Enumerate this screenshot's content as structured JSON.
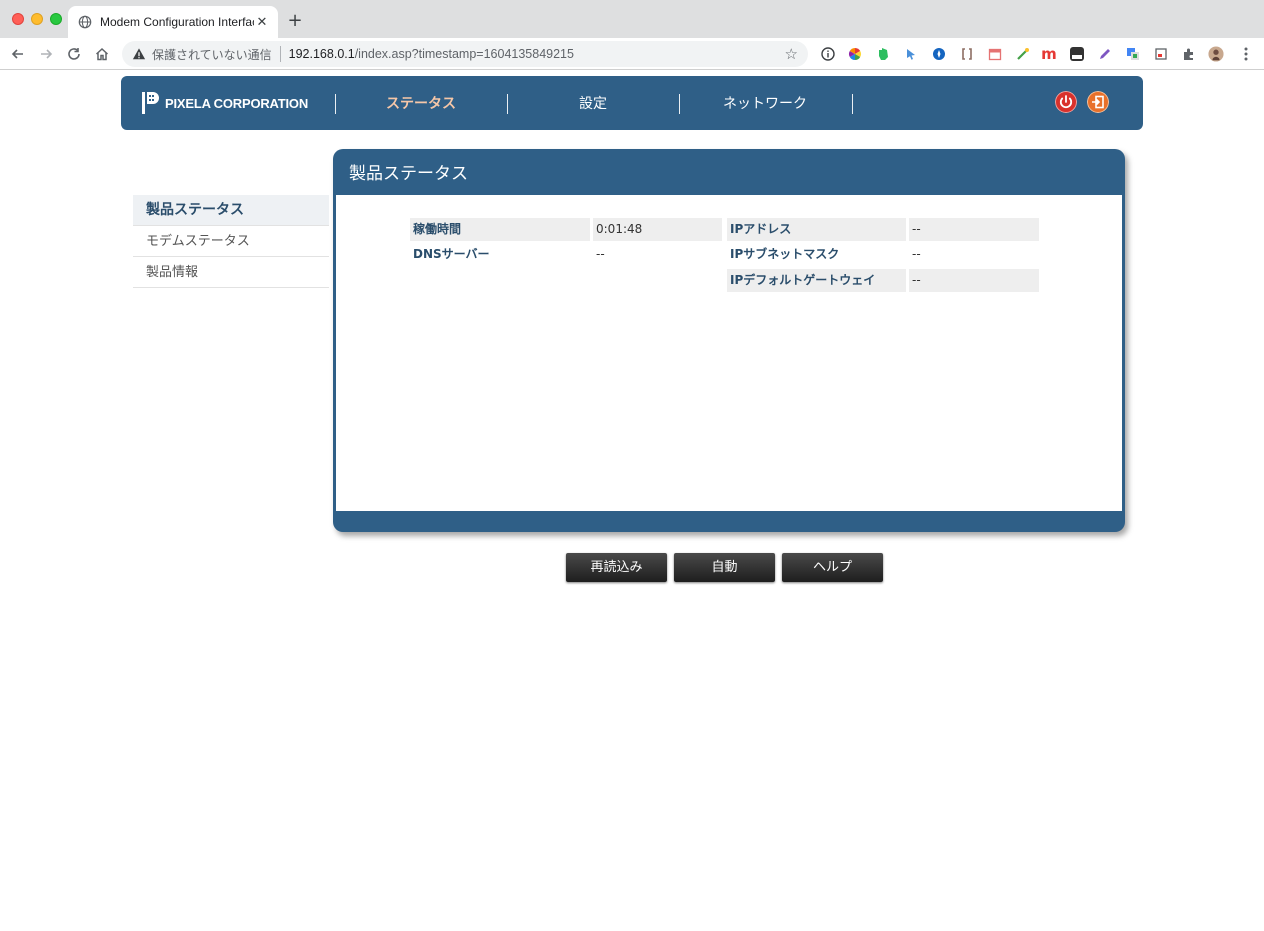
{
  "browser": {
    "tab_title": "Modem Configuration Interface",
    "tab_close": "✕",
    "new_tab": "+",
    "address_insecure_label": "保護されていない通信",
    "address_host": "192.168.0.1",
    "address_path": "/index.asp?timestamp=1604135849215",
    "extensions": [
      "info-icon",
      "color-wheel-icon",
      "evernote-icon",
      "cursor-icon",
      "compass-icon",
      "brackets-icon",
      "calendar-icon",
      "puzzle-color-icon",
      "m-icon",
      "off-icon",
      "pencil-icon",
      "google-translate-icon",
      "window-icon",
      "extensions-icon",
      "avatar-icon",
      "menu-icon"
    ],
    "ext_m_label": "m"
  },
  "header": {
    "logo_text": "PIXELA CORPORATION",
    "nav": [
      "ステータス",
      "設定",
      "ネットワーク"
    ],
    "active_nav": "ステータス"
  },
  "sidebar": {
    "items": [
      {
        "label": "製品ステータス",
        "active": true
      },
      {
        "label": "モデムステータス",
        "active": false
      },
      {
        "label": "製品情報",
        "active": false
      }
    ]
  },
  "panel": {
    "title": "製品ステータス",
    "rows": [
      {
        "label": "稼働時間",
        "value": "0:01:48"
      },
      {
        "label": "DNSサーバー",
        "value": "--"
      },
      {
        "label": "IPアドレス",
        "value": "--"
      },
      {
        "label": "IPサブネットマスク",
        "value": "--"
      },
      {
        "label": "IPデフォルトゲートウェイ",
        "value": "--"
      }
    ]
  },
  "buttons": {
    "reload": "再読込み",
    "auto": "自動",
    "help": "ヘルプ"
  },
  "colors": {
    "header_bg": "#2f5f87",
    "active_nav_text": "#f6c7a8",
    "label_text": "#2a4d6b"
  }
}
